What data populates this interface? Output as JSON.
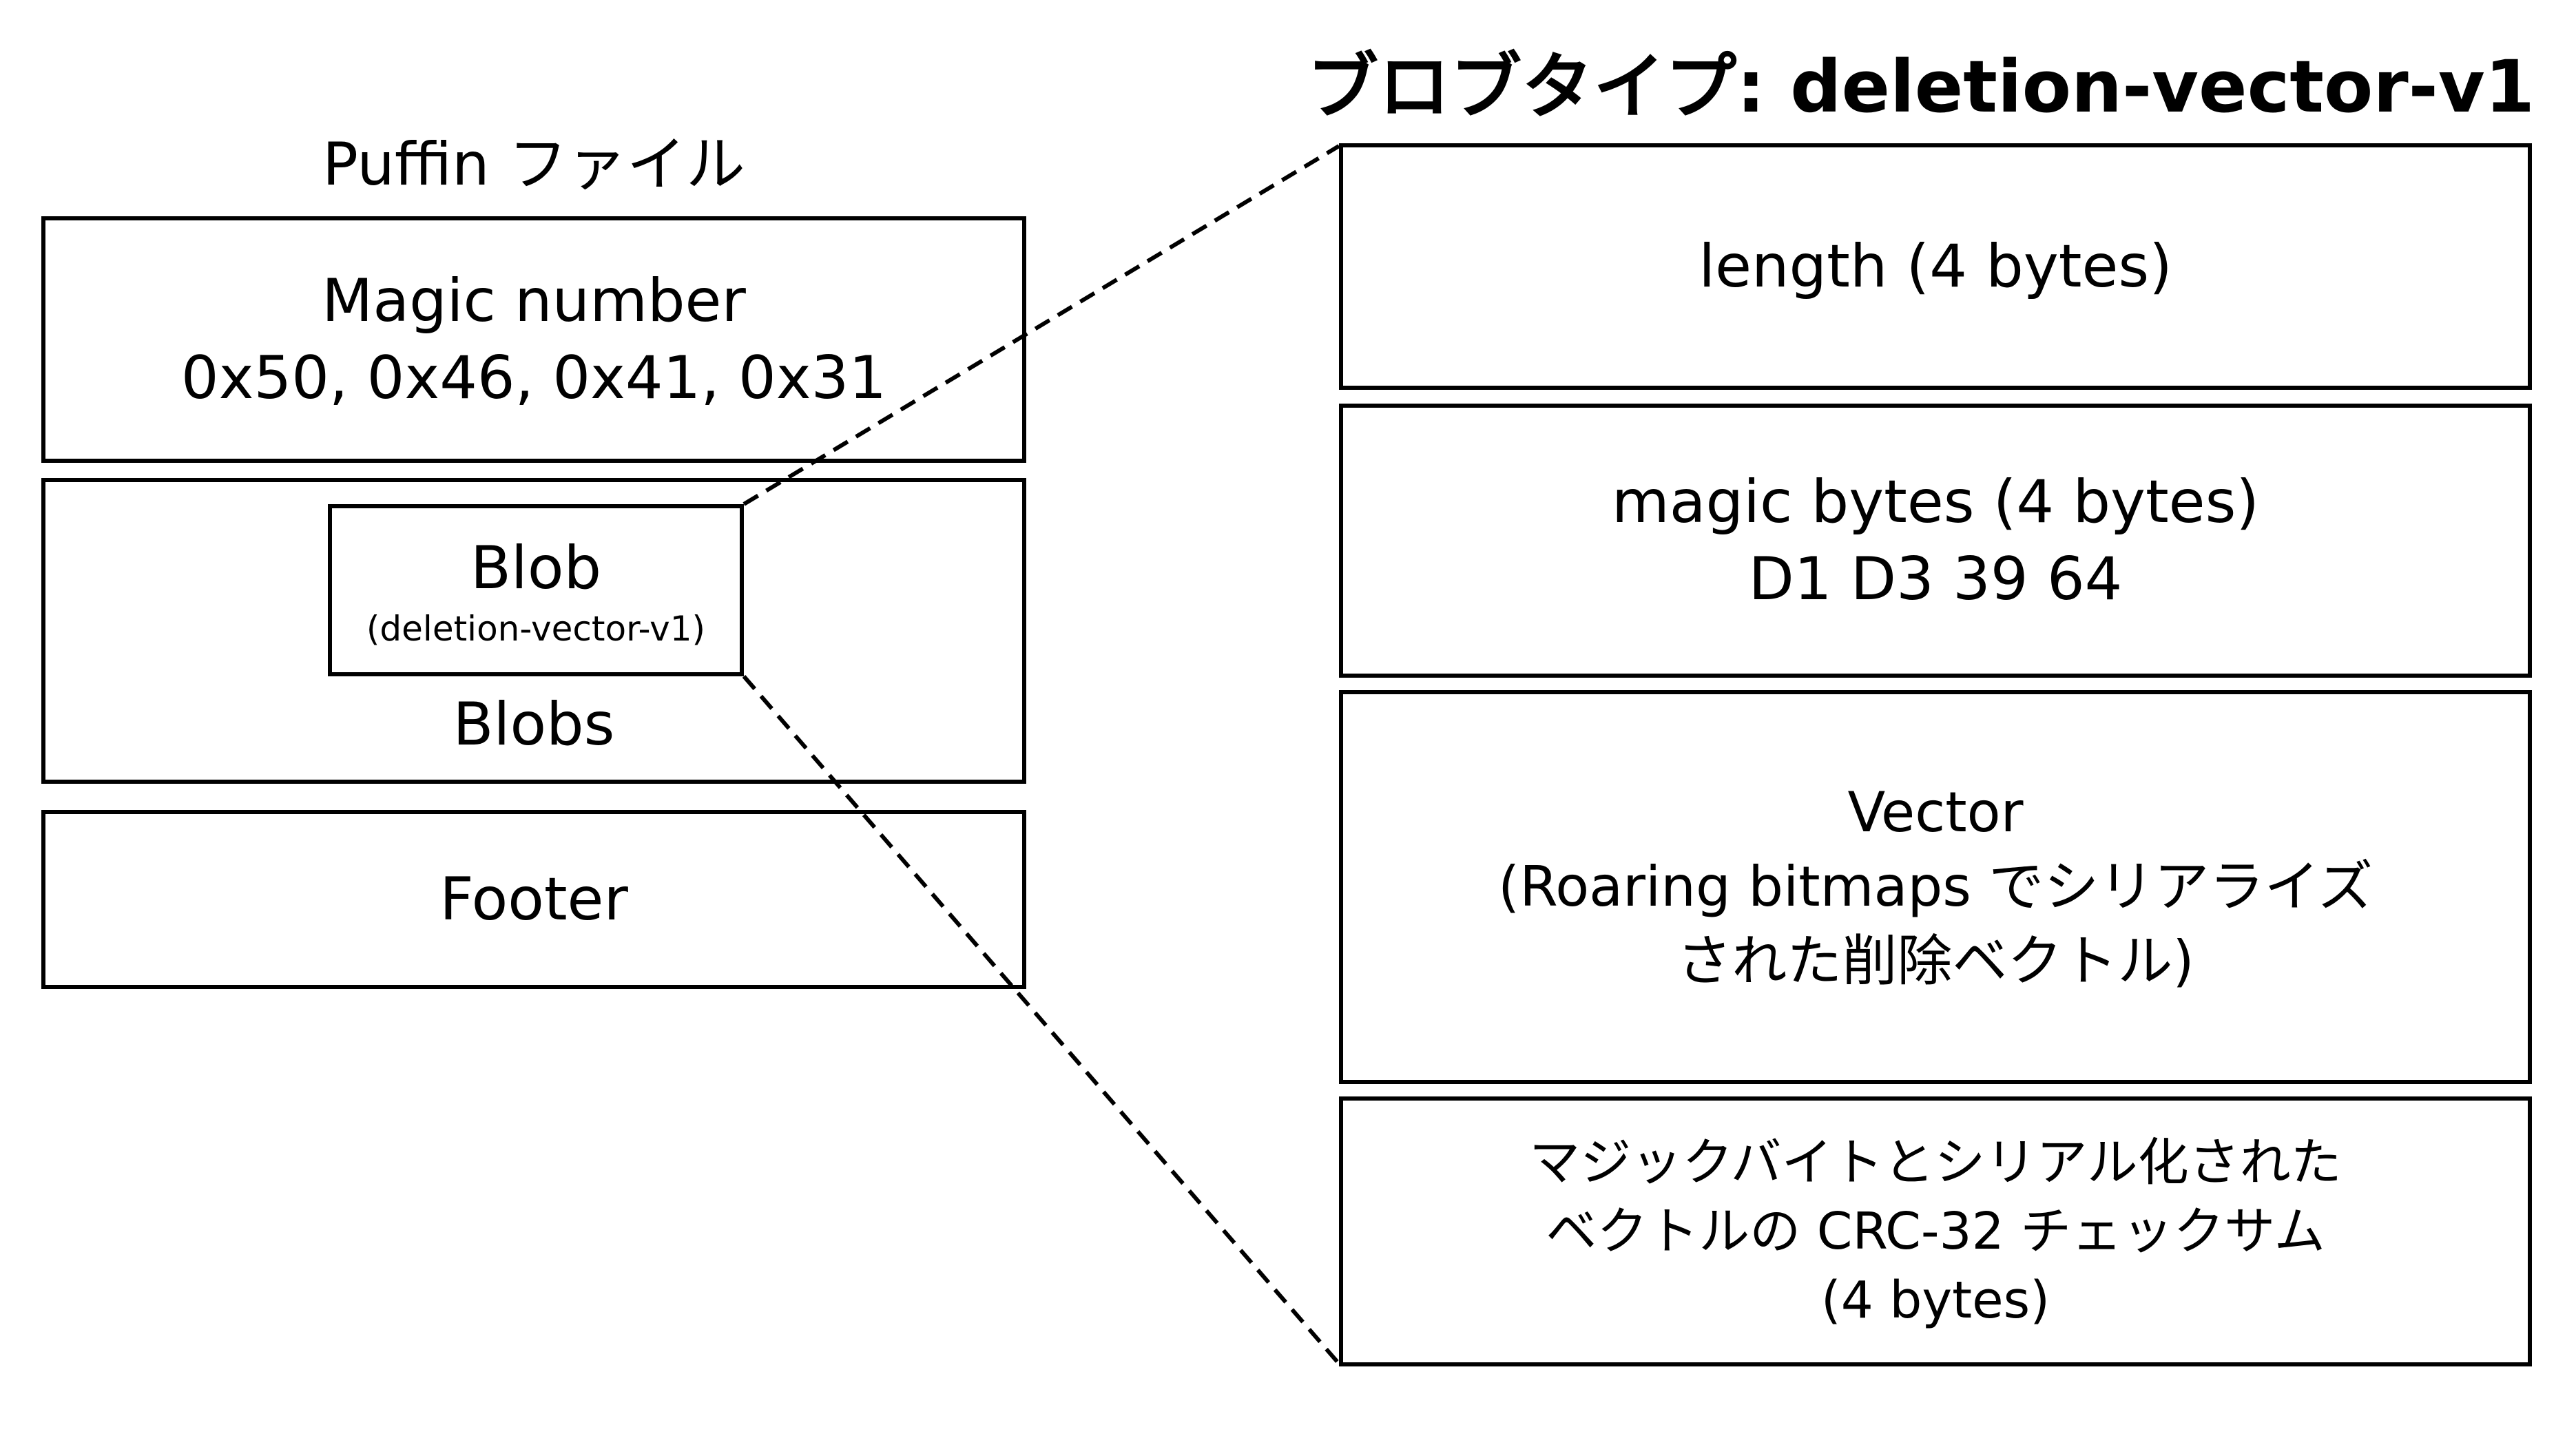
{
  "puffin_file": {
    "title": "Puffin ファイル",
    "magic_number": {
      "label": "Magic number",
      "value": "0x50, 0x46, 0x41, 0x31"
    },
    "blobs": {
      "label": "Blobs",
      "blob": {
        "label": "Blob",
        "subtitle": "(deletion-vector-v1)"
      }
    },
    "footer": {
      "label": "Footer"
    }
  },
  "blob_type": {
    "title": "ブロブタイプ: deletion-vector-v1",
    "fields": {
      "length": {
        "label": "length (4 bytes)"
      },
      "magic_bytes": {
        "label": "magic bytes (4 bytes)",
        "value": "D1 D3 39 64"
      },
      "vector": {
        "label": "Vector",
        "description_line1": "(Roaring bitmaps でシリアライズ",
        "description_line2": "された削除ベクトル)"
      },
      "checksum": {
        "line1": "マジックバイトとシリアル化された",
        "line2": "ベクトルの CRC-32 チェックサム",
        "line3": "(4 bytes)"
      }
    }
  }
}
